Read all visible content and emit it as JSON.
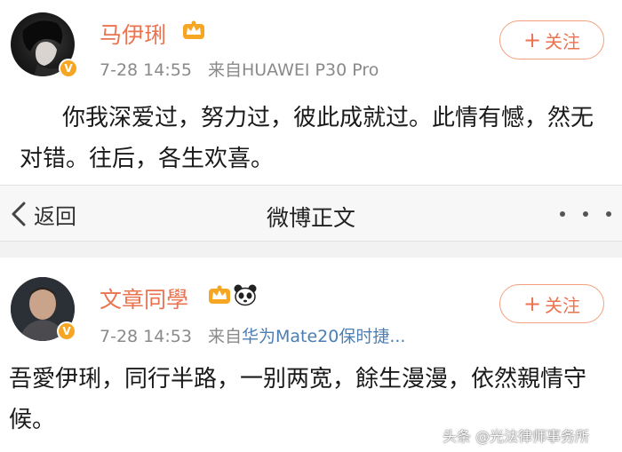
{
  "post1": {
    "username": "马伊琍",
    "time": "7-28 14:55",
    "source": "来自HUAWEI P30 Pro",
    "follow_label": "关注",
    "follow_plus": "+",
    "content": "你我深爱过，努力过，彼此成就过。此情有憾，然无对错。往后，各生欢喜。",
    "badge": "V"
  },
  "navbar": {
    "back_label": "返回",
    "title": "微博正文",
    "back_icon": "chevron-left-icon",
    "more_icon": "more-dots-icon"
  },
  "post2": {
    "username": "文章同學",
    "time": "7-28 14:53",
    "source_prefix": "来自",
    "source_link": "华为Mate20保时捷...",
    "follow_label": "关注",
    "follow_plus": "+",
    "content": "吾愛伊琍，同行半路，一别两宽，餘生漫漫，依然親情守候。",
    "badge": "V"
  },
  "watermark": "头条 @光法律师事务所",
  "colors": {
    "username": "#eb7350",
    "follow_border": "#f2a07e",
    "meta_gray": "#8a8a8a",
    "link_blue": "#4a7fb5",
    "badge_gold": "#f6a623"
  }
}
